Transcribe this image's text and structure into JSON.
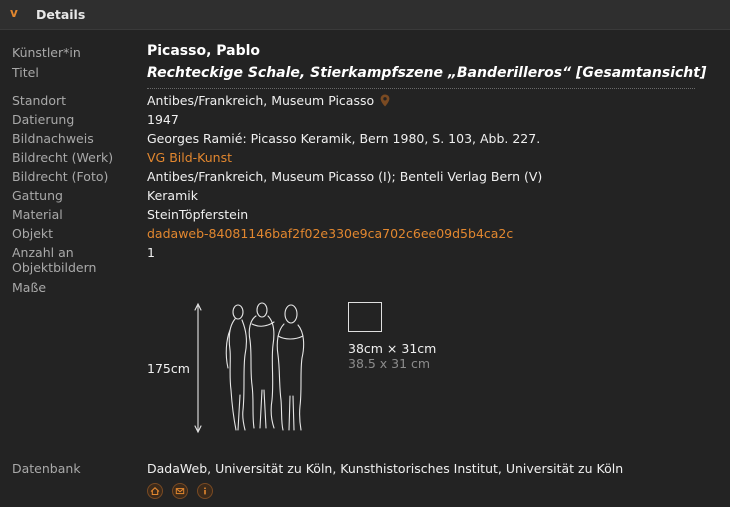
{
  "header": {
    "toggle_symbol": "v",
    "title": "Details"
  },
  "fields": {
    "kuenstler": {
      "label": "Künstler*in",
      "value": "Picasso, Pablo"
    },
    "titel": {
      "label": "Titel",
      "value": "Rechteckige Schale, Stierkampfszene „Banderilleros“ [Gesamtansicht]"
    },
    "standort": {
      "label": "Standort",
      "value": "Antibes/Frankreich, Museum Picasso",
      "icon": "map-pin-icon"
    },
    "datierung": {
      "label": "Datierung",
      "value": "1947"
    },
    "bildnachweis": {
      "label": "Bildnachweis",
      "value": "Georges Ramié: Picasso Keramik, Bern 1980, S. 103, Abb. 227."
    },
    "bildrecht_werk": {
      "label": "Bildrecht (Werk)",
      "value": "VG Bild-Kunst"
    },
    "bildrecht_foto": {
      "label": "Bildrecht (Foto)",
      "value": "Antibes/Frankreich, Museum Picasso (I); Benteli Verlag Bern (V)"
    },
    "gattung": {
      "label": "Gattung",
      "value": "Keramik"
    },
    "material": {
      "label": "Material",
      "value": "SteinTöpferstein"
    },
    "objekt": {
      "label": "Objekt",
      "value": "dadaweb-84081146baf2f02e330e9ca702c6ee09d5b4ca2c"
    },
    "anzahl": {
      "label": "Anzahl an Objektbildern",
      "value": "1"
    },
    "masse": {
      "label": "Maße",
      "human_height": "175cm",
      "dimensions": "38cm × 31cm",
      "dimensions_alt": "38.5 x 31 cm"
    },
    "datenbank": {
      "label": "Datenbank",
      "value": "DadaWeb, Universität zu Köln, Kunsthistorisches Institut, Universität zu Köln",
      "icons": [
        "home-icon",
        "mail-icon",
        "info-icon"
      ]
    }
  },
  "colors": {
    "accent": "#e2872f",
    "background": "#232323",
    "label": "#a9a9a9"
  }
}
